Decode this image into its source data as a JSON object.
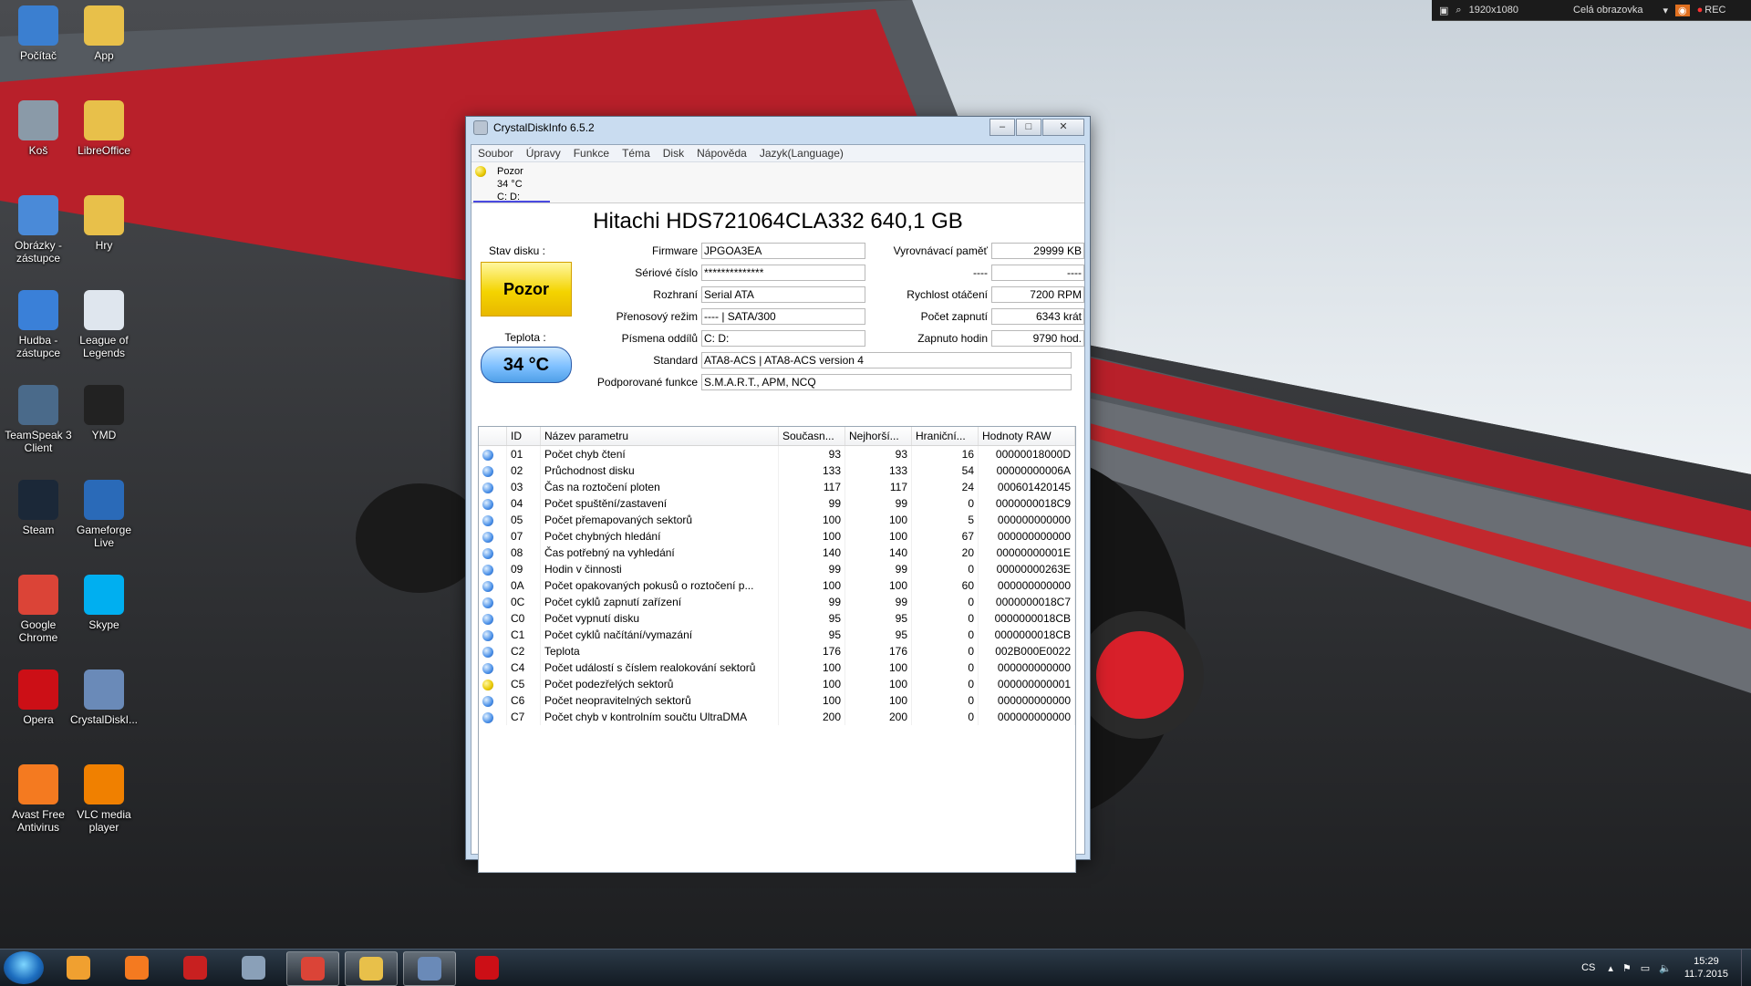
{
  "screen_rec": {
    "resolution": "1920x1080",
    "mode": "Celá obrazovka",
    "rec": "REC"
  },
  "desktop_icons": [
    {
      "label": "Počítač",
      "icon": "computer-icon",
      "color": "#3b7fd0"
    },
    {
      "label": "App",
      "icon": "folder-icon",
      "color": "#e8c04a"
    },
    {
      "label": "Koš",
      "icon": "recycle-bin-icon",
      "color": "#8a9aa8"
    },
    {
      "label": "LibreOffice",
      "icon": "folder-icon",
      "color": "#e8c04a"
    },
    {
      "label": "Obrázky - zástupce",
      "icon": "pictures-icon",
      "color": "#4a8ad8"
    },
    {
      "label": "Hry",
      "icon": "folder-icon",
      "color": "#e8c04a"
    },
    {
      "label": "Hudba - zástupce",
      "icon": "music-icon",
      "color": "#3a80d8"
    },
    {
      "label": "League of Legends",
      "icon": "document-icon",
      "color": "#dfe6ee"
    },
    {
      "label": "TeamSpeak 3 Client",
      "icon": "teamspeak-icon",
      "color": "#4a6a8a"
    },
    {
      "label": "YMD",
      "icon": "youtube-icon",
      "color": "#222222"
    },
    {
      "label": "Steam",
      "icon": "steam-icon",
      "color": "#1b2838"
    },
    {
      "label": "Gameforge Live",
      "icon": "gameforge-icon",
      "color": "#2a6ab8"
    },
    {
      "label": "Google Chrome",
      "icon": "chrome-icon",
      "color": "#db4437"
    },
    {
      "label": "Skype",
      "icon": "skype-icon",
      "color": "#00aff0"
    },
    {
      "label": "Opera",
      "icon": "opera-icon",
      "color": "#cc0f16"
    },
    {
      "label": "CrystalDiskI...",
      "icon": "crystaldiskinfo-icon",
      "color": "#6a8ab8"
    },
    {
      "label": "Avast Free Antivirus",
      "icon": "avast-icon",
      "color": "#f47a20"
    },
    {
      "label": "VLC media player",
      "icon": "vlc-icon",
      "color": "#f08000"
    }
  ],
  "window": {
    "title": "CrystalDiskInfo 6.5.2",
    "menu": [
      "Soubor",
      "Úpravy",
      "Funkce",
      "Téma",
      "Disk",
      "Nápověda",
      "Jazyk(Language)"
    ],
    "disk_tab": {
      "status": "Pozor",
      "temp": "34 °C",
      "drives": "C: D:"
    },
    "disk_title": "Hitachi HDS721064CLA332 640,1 GB",
    "left": {
      "health_label": "Stav disku :",
      "health_value": "Pozor",
      "temp_label": "Teplota :",
      "temp_value": "34 °C"
    },
    "fields": {
      "firmware_label": "Firmware",
      "firmware": "JPGOA3EA",
      "serial_label": "Sériové číslo",
      "serial": "**************",
      "interface_label": "Rozhraní",
      "interface": "Serial ATA",
      "transfer_label": "Přenosový režim",
      "transfer": "---- | SATA/300",
      "letters_label": "Písmena oddílů",
      "letters": "C: D:",
      "standard_label": "Standard",
      "standard": "ATA8-ACS | ATA8-ACS version 4",
      "features_label": "Podporované funkce",
      "features": "S.M.A.R.T., APM, NCQ",
      "buffer_label": "Vyrovnávací paměť",
      "buffer": "29999 KB",
      "blank_label": "----",
      "blank": "----",
      "rpm_label": "Rychlost otáčení",
      "rpm": "7200 RPM",
      "power_count_label": "Počet zapnutí",
      "power_count": "6343 krát",
      "power_hours_label": "Zapnuto hodin",
      "power_hours": "9790 hod."
    },
    "table_headers": [
      "ID",
      "Název parametru",
      "Současn...",
      "Nejhorší...",
      "Hraniční...",
      "Hodnoty RAW"
    ],
    "smart": [
      {
        "id": "01",
        "name": "Počet chyb čtení",
        "cur": "93",
        "worst": "93",
        "thr": "16",
        "raw": "00000018000D",
        "warn": false
      },
      {
        "id": "02",
        "name": "Průchodnost disku",
        "cur": "133",
        "worst": "133",
        "thr": "54",
        "raw": "00000000006A",
        "warn": false
      },
      {
        "id": "03",
        "name": "Čas na roztočení ploten",
        "cur": "117",
        "worst": "117",
        "thr": "24",
        "raw": "000601420145",
        "warn": false
      },
      {
        "id": "04",
        "name": "Počet spuštění/zastavení",
        "cur": "99",
        "worst": "99",
        "thr": "0",
        "raw": "0000000018C9",
        "warn": false
      },
      {
        "id": "05",
        "name": "Počet přemapovaných sektorů",
        "cur": "100",
        "worst": "100",
        "thr": "5",
        "raw": "000000000000",
        "warn": false
      },
      {
        "id": "07",
        "name": "Počet chybných hledání",
        "cur": "100",
        "worst": "100",
        "thr": "67",
        "raw": "000000000000",
        "warn": false
      },
      {
        "id": "08",
        "name": "Čas potřebný na vyhledání",
        "cur": "140",
        "worst": "140",
        "thr": "20",
        "raw": "00000000001E",
        "warn": false
      },
      {
        "id": "09",
        "name": "Hodin v činnosti",
        "cur": "99",
        "worst": "99",
        "thr": "0",
        "raw": "00000000263E",
        "warn": false
      },
      {
        "id": "0A",
        "name": "Počet opakovaných pokusů o roztočení p...",
        "cur": "100",
        "worst": "100",
        "thr": "60",
        "raw": "000000000000",
        "warn": false
      },
      {
        "id": "0C",
        "name": "Počet cyklů zapnutí zařízení",
        "cur": "99",
        "worst": "99",
        "thr": "0",
        "raw": "0000000018C7",
        "warn": false
      },
      {
        "id": "C0",
        "name": "Počet vypnutí disku",
        "cur": "95",
        "worst": "95",
        "thr": "0",
        "raw": "0000000018CB",
        "warn": false
      },
      {
        "id": "C1",
        "name": "Počet cyklů načítání/vymazání",
        "cur": "95",
        "worst": "95",
        "thr": "0",
        "raw": "0000000018CB",
        "warn": false
      },
      {
        "id": "C2",
        "name": "Teplota",
        "cur": "176",
        "worst": "176",
        "thr": "0",
        "raw": "002B000E0022",
        "warn": false
      },
      {
        "id": "C4",
        "name": "Počet událostí s číslem realokování sektorů",
        "cur": "100",
        "worst": "100",
        "thr": "0",
        "raw": "000000000000",
        "warn": false
      },
      {
        "id": "C5",
        "name": "Počet podezřelých sektorů",
        "cur": "100",
        "worst": "100",
        "thr": "0",
        "raw": "000000000001",
        "warn": true
      },
      {
        "id": "C6",
        "name": "Počet neopravitelných sektorů",
        "cur": "100",
        "worst": "100",
        "thr": "0",
        "raw": "000000000000",
        "warn": false
      },
      {
        "id": "C7",
        "name": "Počet chyb v kontrolním součtu UltraDMA",
        "cur": "200",
        "worst": "200",
        "thr": "0",
        "raw": "000000000000",
        "warn": false
      }
    ]
  },
  "taskbar": {
    "apps": [
      {
        "icon": "media-player-icon",
        "color": "#f0a030"
      },
      {
        "icon": "avast-icon",
        "color": "#f47a20"
      },
      {
        "icon": "record-icon",
        "color": "#c82020"
      },
      {
        "icon": "diskinfo-tray-icon",
        "color": "#8aa0b8"
      },
      {
        "icon": "chrome-icon",
        "color": "#db4437"
      },
      {
        "icon": "explorer-folder-icon",
        "color": "#e8c04a"
      },
      {
        "icon": "crystaldiskinfo-icon",
        "color": "#6a8ab8"
      },
      {
        "icon": "opera-icon",
        "color": "#cc0f16"
      }
    ],
    "lang": "CS",
    "time": "15:29",
    "date": "11.7.2015"
  }
}
